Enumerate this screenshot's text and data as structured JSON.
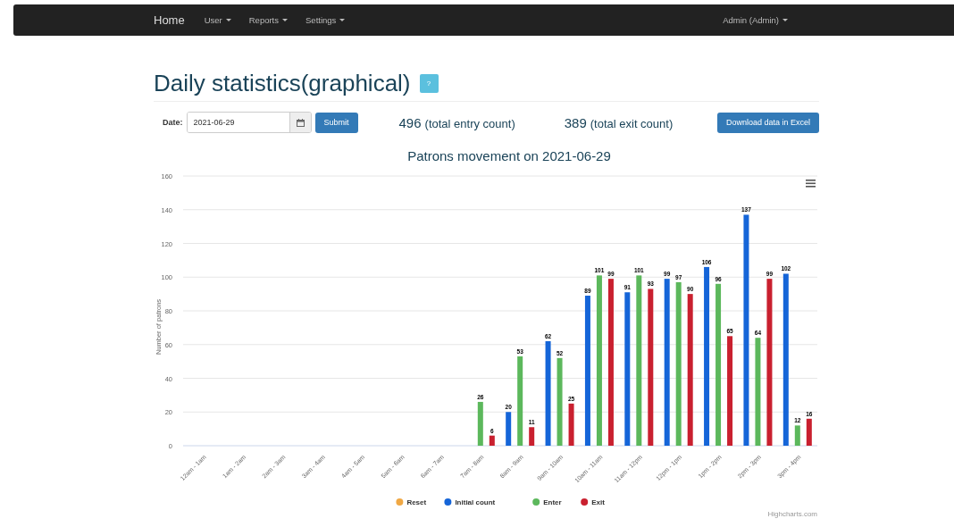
{
  "navbar": {
    "brand": "Home",
    "menus": [
      {
        "label": "User"
      },
      {
        "label": "Reports"
      },
      {
        "label": "Settings"
      }
    ],
    "user_menu": {
      "label": "Admin (Admin)"
    }
  },
  "page": {
    "title": "Daily statistics(graphical)",
    "help_button": "?"
  },
  "toolbar": {
    "date_label": "Date:",
    "date_value": "2021-06-29",
    "submit": "Submit",
    "entry_total": "496",
    "entry_caption": "(total entry count)",
    "exit_total": "389",
    "exit_caption": "(total exit count)",
    "download": "Download data in Excel"
  },
  "chart": {
    "credits": "Highcharts.com",
    "chart_data": {
      "type": "bar",
      "title": "Patrons movement on 2021-06-29",
      "ylabel": "Number of patrons",
      "ylim": [
        0,
        160
      ],
      "grid": true,
      "legend": true,
      "yticks": [
        0,
        20,
        40,
        60,
        80,
        100,
        120,
        140,
        160
      ],
      "data_labels": true,
      "categories": [
        "12am - 1am",
        "1am - 2am",
        "2am - 3am",
        "3am - 4am",
        "4am - 5am",
        "5am - 6am",
        "6am - 7am",
        "7am - 8am",
        "8am - 9am",
        "9am - 10am",
        "10am - 11am",
        "11am - 12pm",
        "12pm - 1pm",
        "1pm - 2pm",
        "2pm - 3pm",
        "3pm - 4pm"
      ],
      "series": [
        {
          "name": "Reset",
          "color": "#f0a844",
          "values": [
            null,
            null,
            null,
            null,
            null,
            null,
            null,
            null,
            null,
            null,
            null,
            null,
            null,
            null,
            null,
            null
          ]
        },
        {
          "name": "Initial count",
          "color": "#1565d8",
          "values": [
            null,
            null,
            null,
            null,
            null,
            null,
            null,
            null,
            20,
            62,
            89,
            91,
            99,
            106,
            137,
            102
          ]
        },
        {
          "name": "Enter",
          "color": "#5cb85c",
          "values": [
            null,
            null,
            null,
            null,
            null,
            null,
            null,
            26,
            53,
            52,
            101,
            101,
            97,
            96,
            64,
            12
          ]
        },
        {
          "name": "Exit",
          "color": "#c9202f",
          "values": [
            null,
            null,
            null,
            null,
            null,
            null,
            null,
            6,
            11,
            25,
            99,
            93,
            90,
            65,
            99,
            16
          ]
        }
      ]
    }
  }
}
